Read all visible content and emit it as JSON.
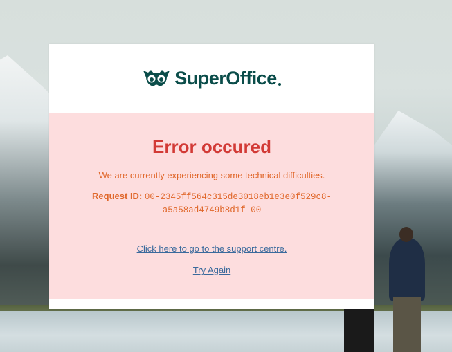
{
  "brand": {
    "name": "SuperOffice",
    "logo_icon": "owl-eyes-icon",
    "color": "#0b4d4a"
  },
  "error": {
    "title": "Error occured",
    "message": "We are currently experiencing some technical difficulties.",
    "request_label": "Request ID:",
    "request_id": "00-2345ff564c315de3018eb1e3e0f529c8-a5a58ad4749b8d1f-00",
    "title_color": "#d23a36",
    "text_color": "#e0672a",
    "panel_color": "#fdddde"
  },
  "links": {
    "support": "Click here to go to the support centre.",
    "retry": "Try Again",
    "link_color": "#3a6a9c"
  }
}
